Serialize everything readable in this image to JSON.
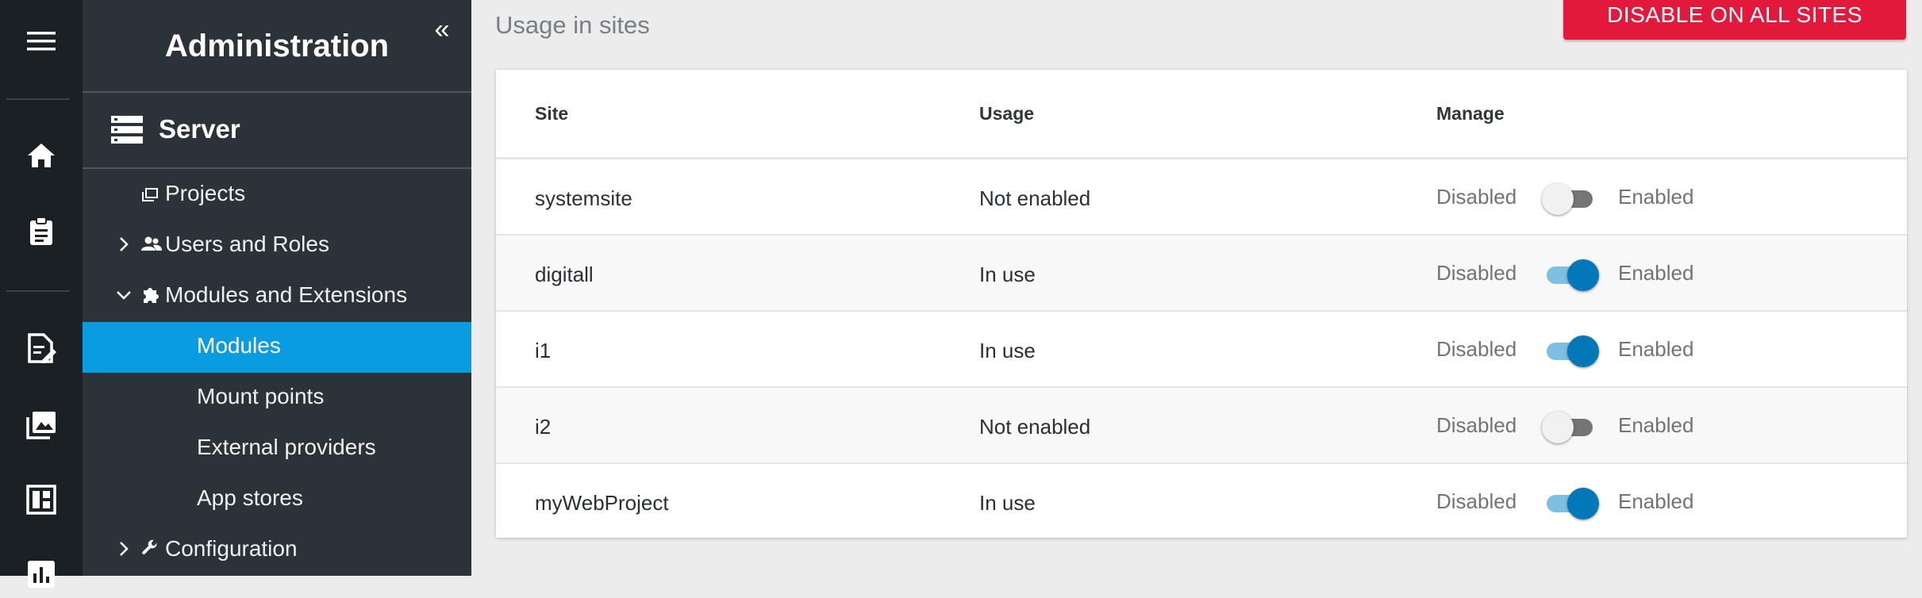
{
  "sidebar": {
    "title": "Administration",
    "collapse_glyph": "«",
    "section": "Server",
    "items": [
      {
        "label": "Projects",
        "icon": "projects-icon",
        "expandable": false
      },
      {
        "label": "Users and Roles",
        "icon": "users-icon",
        "expandable": true,
        "expanded": false
      },
      {
        "label": "Modules and Extensions",
        "icon": "puzzle-icon",
        "expandable": true,
        "expanded": true
      },
      {
        "label": "Modules",
        "active": true
      },
      {
        "label": "Mount points"
      },
      {
        "label": "External providers"
      },
      {
        "label": "App stores"
      },
      {
        "label": "Configuration",
        "icon": "wrench-icon",
        "expandable": true,
        "expanded": false
      }
    ]
  },
  "rail_icons": [
    "menu-icon",
    "home-icon",
    "clipboard-icon",
    "document-edit-icon",
    "images-icon",
    "dashboard-icon",
    "chart-icon"
  ],
  "main": {
    "section_title": "Usage in sites",
    "disable_button": "DISABLE ON ALL SITES",
    "columns": [
      "Site",
      "Usage",
      "Manage"
    ],
    "rows": [
      {
        "site": "systemsite",
        "usage": "Not enabled",
        "enabled": false
      },
      {
        "site": "digitall",
        "usage": "In use",
        "enabled": true
      },
      {
        "site": "i1",
        "usage": "In use",
        "enabled": true
      },
      {
        "site": "i2",
        "usage": "Not enabled",
        "enabled": false
      },
      {
        "site": "myWebProject",
        "usage": "In use",
        "enabled": true
      }
    ],
    "toggle_off_label": "Disabled",
    "toggle_on_label": "Enabled"
  },
  "colors": {
    "rail_bg": "#1b2024",
    "panel_bg": "#2b3238",
    "active_item": "#0a9ce0",
    "danger_button": "#e3193b",
    "toggle_on": "#0378b8"
  }
}
